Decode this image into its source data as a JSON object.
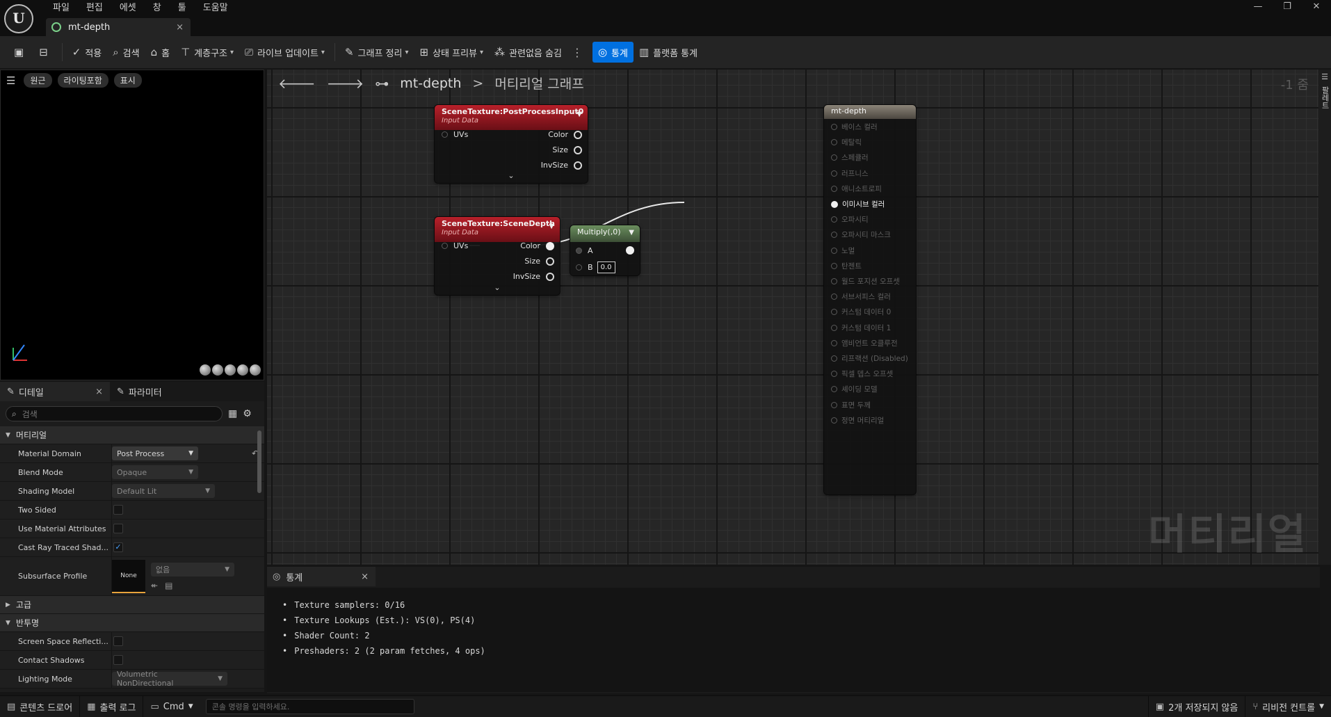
{
  "menu": [
    "파일",
    "편집",
    "에셋",
    "창",
    "툴",
    "도움말"
  ],
  "logo_text": "U",
  "doc_tab": {
    "label": "mt-depth",
    "close": "×"
  },
  "window_controls": {
    "min": "—",
    "max": "❐",
    "close": "✕"
  },
  "toolbar": {
    "save_icon": "💾",
    "apply": "적용",
    "search": "검색",
    "home": "홈",
    "hierarchy": "계층구조",
    "live_update": "라이브 업데이트",
    "graph_cleanup": "그래프 정리",
    "preview_state": "상태 프리뷰",
    "hide_unrelated": "관련없음 숨김",
    "stats": "통계",
    "platform_stats": "플랫폼 통계"
  },
  "viewport": {
    "buttons": [
      "원근",
      "라이팅포함",
      "표시"
    ]
  },
  "details": {
    "tab_details": "디테일",
    "tab_params": "파라미터",
    "search_placeholder": "검색",
    "section_material": "머티리얼",
    "section_advanced": "고급",
    "section_translucency": "반투명",
    "rows": [
      {
        "label": "Material Domain",
        "value": "Post Process"
      },
      {
        "label": "Blend Mode",
        "value": "Opaque"
      },
      {
        "label": "Shading Model",
        "value": "Default Lit"
      },
      {
        "label": "Two Sided",
        "checked": false
      },
      {
        "label": "Use Material Attributes",
        "checked": false
      },
      {
        "label": "Cast Ray Traced Shad...",
        "checked": true
      },
      {
        "label": "Subsurface Profile",
        "thumb": "None",
        "value": "없음"
      }
    ],
    "trans_rows": [
      {
        "label": "Screen Space Reflecti...",
        "checked": false
      },
      {
        "label": "Contact Shadows",
        "checked": false
      },
      {
        "label": "Lighting Mode",
        "value": "Volumetric NonDirectional"
      }
    ],
    "check_mark": "✓"
  },
  "graph": {
    "breadcrumb_root": "mt-depth",
    "breadcrumb_sep": ">",
    "breadcrumb_sub": "머티리얼 그래프",
    "zoom": "-1 줌",
    "watermark": "머티리얼",
    "right_strip": "팔레트"
  },
  "nodes": {
    "pp_input": {
      "title": "SceneTexture:PostProcessInput0",
      "subtitle": "Input Data",
      "in": "UVs",
      "outs": [
        "Color",
        "Size",
        "InvSize"
      ]
    },
    "scene_depth": {
      "title": "SceneTexture:SceneDepth",
      "subtitle": "Input Data",
      "in": "UVs",
      "outs": [
        "Color",
        "Size",
        "InvSize"
      ]
    },
    "multiply": {
      "title": "Multiply(,0)",
      "a": "A",
      "b": "B",
      "b_value": "0.0"
    },
    "material": {
      "title": "mt-depth",
      "inputs": [
        "베이스 컬러",
        "메탈릭",
        "스페큘러",
        "러프니스",
        "애니소트로피",
        "이미시브 컬러",
        "오파시티",
        "오파시티 마스크",
        "노멀",
        "탄젠트",
        "월드 포지션 오프셋",
        "서브서피스 컬러",
        "커스텀 데이터 0",
        "커스텀 데이터 1",
        "앰비언트 오클루전",
        "리프랙션 (Disabled)",
        "픽셀 뎁스 오프셋",
        "셰이딩 모델",
        "표면 두께",
        "정면 머티리얼"
      ],
      "active_index": 5
    }
  },
  "stats": {
    "tab": "통계",
    "lines": [
      "Texture samplers: 0/16",
      "Texture Lookups (Est.): VS(0), PS(4)",
      "Shader Count: 2",
      "Preshaders: 2  (2 param fetches, 4 ops)"
    ]
  },
  "bottom": {
    "content_drawer": "콘텐츠 드로어",
    "output_log": "출력 로그",
    "cmd": "Cmd",
    "console_placeholder": "콘솔 명령을 입력하세요.",
    "unsaved": "2개 저장되지 않음",
    "revision": "리비전 컨트롤"
  }
}
